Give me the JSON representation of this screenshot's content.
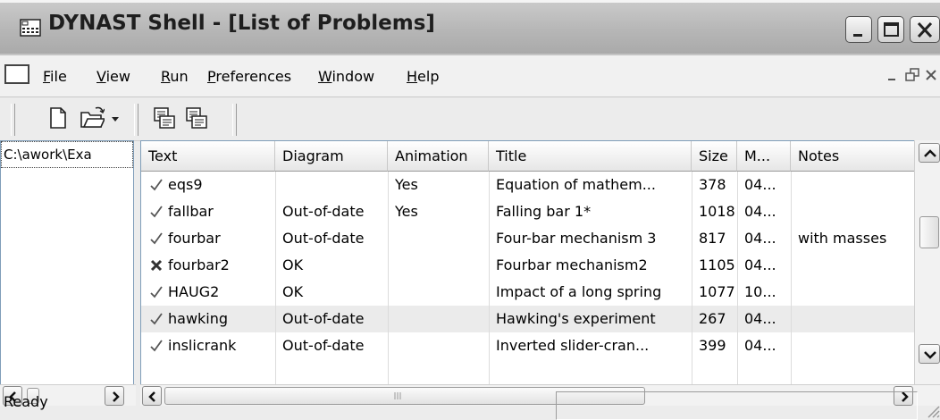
{
  "window": {
    "title": "DYNAST Shell - [List of Problems]",
    "icon": "app-icon"
  },
  "menu": [
    "File",
    "View",
    "Run",
    "Preferences",
    "Window",
    "Help"
  ],
  "left_pane": {
    "path": "C:\\awork\\Exa"
  },
  "list": {
    "columns": [
      "Text",
      "Diagram",
      "Animation",
      "Title",
      "Size",
      "M...",
      "Notes"
    ],
    "rows": [
      {
        "status": "ok",
        "text": "eqs9",
        "diagram": "",
        "animation": "Yes",
        "title": "Equation of mathem...",
        "size": "378",
        "m": "04...",
        "notes": ""
      },
      {
        "status": "ok",
        "text": "fallbar",
        "diagram": "Out-of-date",
        "animation": "Yes",
        "title": "Falling bar 1*",
        "size": "1018",
        "m": "04...",
        "notes": ""
      },
      {
        "status": "ok",
        "text": "fourbar",
        "diagram": "Out-of-date",
        "animation": "",
        "title": "Four-bar mechanism 3",
        "size": "817",
        "m": "04...",
        "notes": "with masses"
      },
      {
        "status": "error",
        "text": "fourbar2",
        "diagram": "OK",
        "animation": "",
        "title": "Fourbar mechanism2",
        "size": "1105",
        "m": "04...",
        "notes": ""
      },
      {
        "status": "ok",
        "text": "HAUG2",
        "diagram": "OK",
        "animation": "",
        "title": "Impact of a long spring",
        "size": "1077",
        "m": "10...",
        "notes": ""
      },
      {
        "status": "ok",
        "text": "hawking",
        "diagram": "Out-of-date",
        "animation": "",
        "title": "Hawking's experiment",
        "size": "267",
        "m": "04...",
        "notes": ""
      },
      {
        "status": "ok",
        "text": "inslicrank",
        "diagram": "Out-of-date",
        "animation": "",
        "title": "Inverted slider-cran...",
        "size": "399",
        "m": "04...",
        "notes": ""
      }
    ],
    "selected_row": "hawking"
  },
  "status": {
    "text": "Ready"
  }
}
